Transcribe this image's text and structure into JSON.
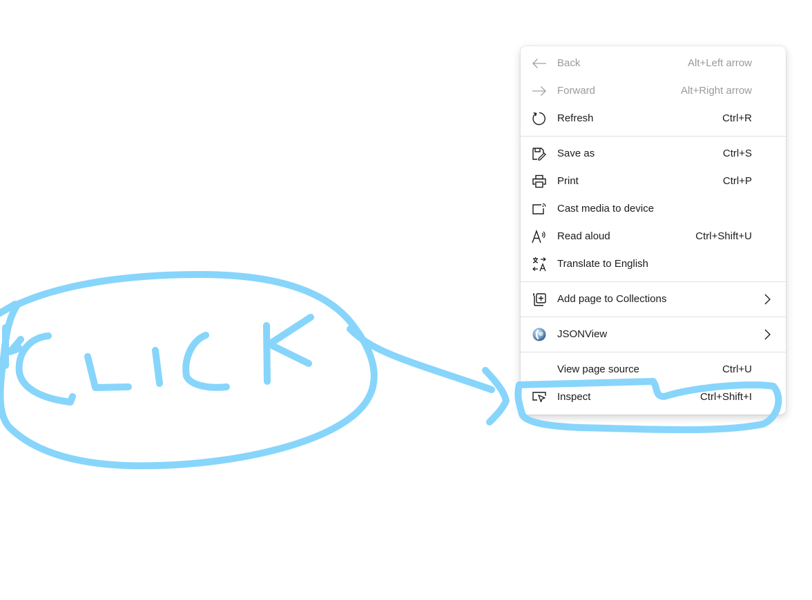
{
  "context_menu": {
    "back": {
      "label": "Back",
      "shortcut": "Alt+Left arrow"
    },
    "forward": {
      "label": "Forward",
      "shortcut": "Alt+Right arrow"
    },
    "refresh": {
      "label": "Refresh",
      "shortcut": "Ctrl+R"
    },
    "save_as": {
      "label": "Save as",
      "shortcut": "Ctrl+S"
    },
    "print": {
      "label": "Print",
      "shortcut": "Ctrl+P"
    },
    "cast": {
      "label": "Cast media to device"
    },
    "read_aloud": {
      "label": "Read aloud",
      "shortcut": "Ctrl+Shift+U"
    },
    "translate": {
      "label": "Translate to English"
    },
    "collections": {
      "label": "Add page to Collections"
    },
    "jsonview": {
      "label": "JSONView"
    },
    "view_source": {
      "label": "View page source",
      "shortcut": "Ctrl+U"
    },
    "inspect": {
      "label": "Inspect",
      "shortcut": "Ctrl+Shift+I"
    }
  },
  "annotation": {
    "text": "CLICK",
    "stroke_color": "#87d5fb"
  }
}
